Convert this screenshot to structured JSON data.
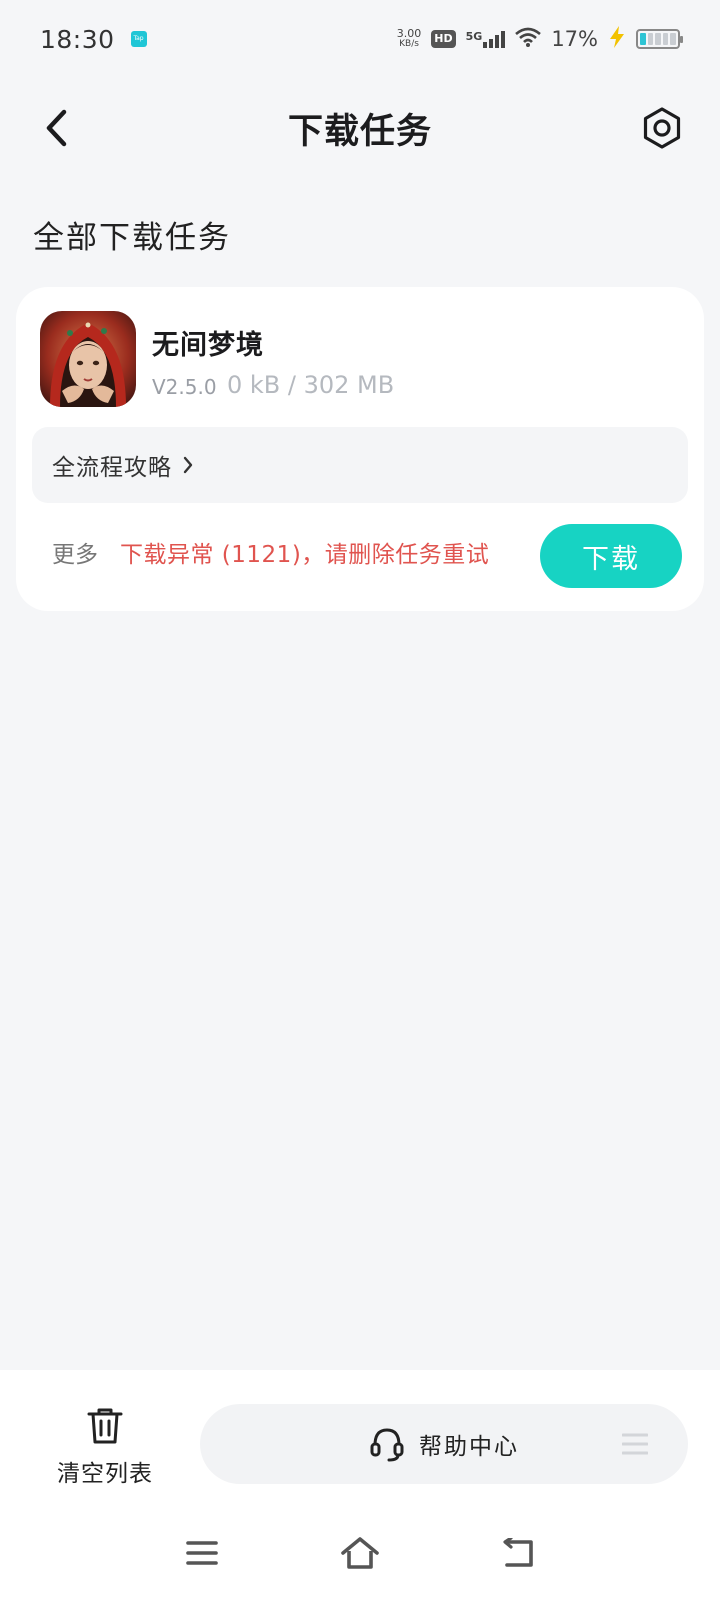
{
  "status_bar": {
    "time": "18:30",
    "app_badge": "Tap",
    "net_speed_value": "3.00",
    "net_speed_unit": "KB/s",
    "hd_label": "HD",
    "network_label": "5G",
    "battery_percent": "17%",
    "battery_level": 0.17
  },
  "header": {
    "title": "下载任务",
    "back_icon": "chevron-left-icon",
    "settings_icon": "hexagon-gear-icon"
  },
  "section": {
    "title": "全部下载任务"
  },
  "task": {
    "app_name": "无间梦境",
    "version": "V2.5.0",
    "size_progress": "0 kB / 302 MB",
    "guide_label": "全流程攻略",
    "more_label": "更多",
    "error_message": "下载异常 (1121)，请删除任务重试",
    "download_label": "下载"
  },
  "bottom_bar": {
    "clear_label": "清空列表",
    "help_label": "帮助中心"
  },
  "nav": {
    "menu_icon": "menu-icon",
    "home_icon": "home-icon",
    "back_icon": "back-icon"
  },
  "colors": {
    "accent": "#17d3c3",
    "error": "#e0544f",
    "background": "#f5f6f8"
  }
}
